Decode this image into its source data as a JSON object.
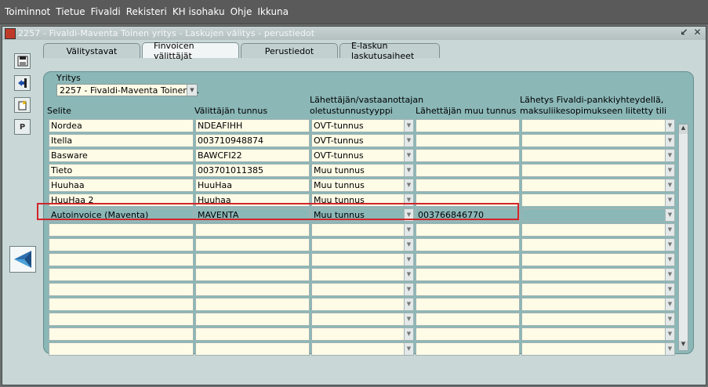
{
  "menu": [
    "Toiminnot",
    "Tietue",
    "Fivaldi",
    "Rekisteri",
    "KH isohaku",
    "Ohje",
    "Ikkuna"
  ],
  "window": {
    "title": "2257 - Fivaldi-Maventa Toinen yritys - Laskujen välitys - perustiedot",
    "tabs": [
      "Välitystavat",
      "Finvoicen välittäjät",
      "Perustiedot",
      "E-laskun laskutusaiheet"
    ],
    "active_tab": "Finvoicen välittäjät"
  },
  "toolbar": {
    "p_label": "P"
  },
  "company": {
    "label": "Yritys",
    "value": "2257 - Fivaldi-Maventa Toinen ..."
  },
  "headers": {
    "selite": "Selite",
    "tunnus": "Välittäjän tunnus",
    "tyyppi_1": "Lähettäjän/vastaanottajan",
    "tyyppi_2": "oletustunnustyyppi",
    "muu": "Lähettäjän muu tunnus",
    "lahetys_1": "Lähetys Fivaldi-pankkiyhteydellä,",
    "lahetys_2": "maksuliikesopimukseen liitetty tili"
  },
  "rows": [
    {
      "selite": "Nordea",
      "tunnus": "NDEAFIHH",
      "tyyppi": "OVT-tunnus",
      "muu": "",
      "tili": ""
    },
    {
      "selite": "Itella",
      "tunnus": "003710948874",
      "tyyppi": "OVT-tunnus",
      "muu": "",
      "tili": ""
    },
    {
      "selite": "Basware",
      "tunnus": "BAWCFI22",
      "tyyppi": "OVT-tunnus",
      "muu": "",
      "tili": ""
    },
    {
      "selite": "Tieto",
      "tunnus": "003701011385",
      "tyyppi": "Muu tunnus",
      "muu": "",
      "tili": ""
    },
    {
      "selite": "Huuhaa",
      "tunnus": "HuuHaa",
      "tyyppi": "Muu tunnus",
      "muu": "",
      "tili": ""
    },
    {
      "selite": "HuuHaa 2",
      "tunnus": "Huuhaa",
      "tyyppi": "Muu tunnus",
      "muu": "",
      "tili": ""
    },
    {
      "selite": "Autoinvoice (Maventa)",
      "tunnus": "MAVENTA",
      "tyyppi": "Muu tunnus",
      "muu": "003766846770",
      "tili": ""
    },
    {
      "selite": "",
      "tunnus": "",
      "tyyppi": "",
      "muu": "",
      "tili": ""
    },
    {
      "selite": "",
      "tunnus": "",
      "tyyppi": "",
      "muu": "",
      "tili": ""
    },
    {
      "selite": "",
      "tunnus": "",
      "tyyppi": "",
      "muu": "",
      "tili": ""
    },
    {
      "selite": "",
      "tunnus": "",
      "tyyppi": "",
      "muu": "",
      "tili": ""
    },
    {
      "selite": "",
      "tunnus": "",
      "tyyppi": "",
      "muu": "",
      "tili": ""
    },
    {
      "selite": "",
      "tunnus": "",
      "tyyppi": "",
      "muu": "",
      "tili": ""
    },
    {
      "selite": "",
      "tunnus": "",
      "tyyppi": "",
      "muu": "",
      "tili": ""
    },
    {
      "selite": "",
      "tunnus": "",
      "tyyppi": "",
      "muu": "",
      "tili": ""
    },
    {
      "selite": "",
      "tunnus": "",
      "tyyppi": "",
      "muu": "",
      "tili": ""
    }
  ],
  "selected_row": 6,
  "colors": {
    "highlight": "#d0262a",
    "panel": "#8bb7b7",
    "field": "#fefbe6"
  }
}
